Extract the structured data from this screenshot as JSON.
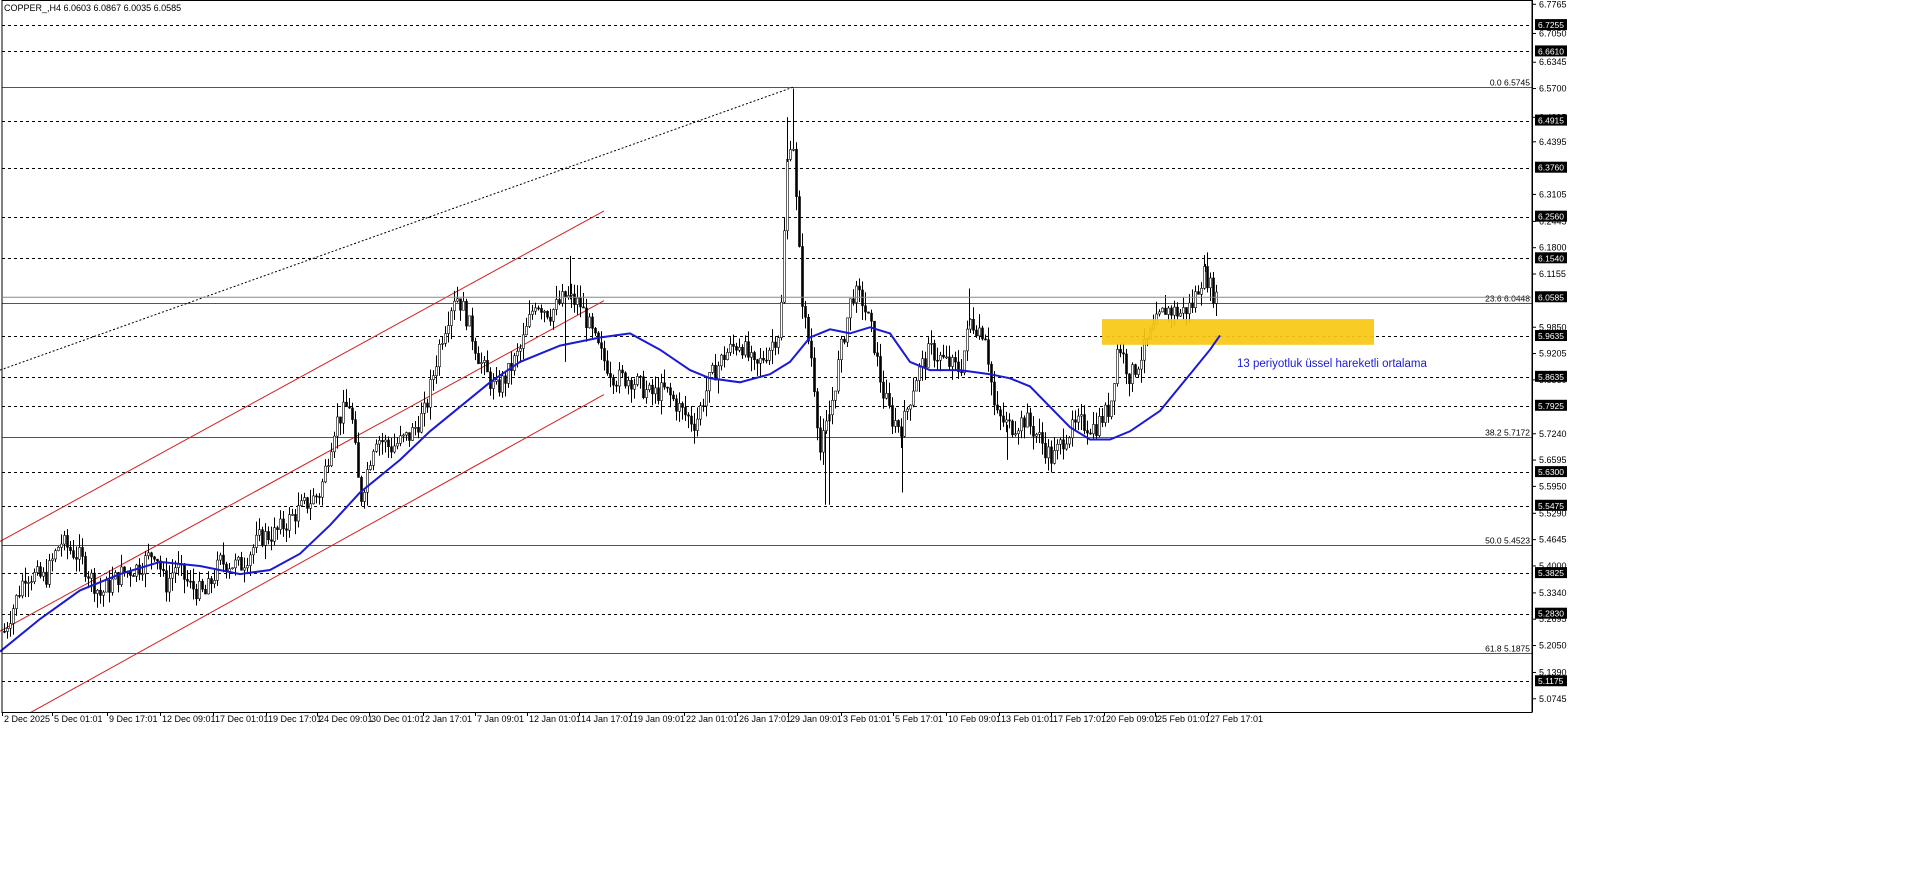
{
  "chart_data": {
    "type": "candlestick",
    "title": "COPPER_,H4  6.0603 6.0867 6.0035 6.0585",
    "ylim": [
      5.0,
      6.7765
    ],
    "yticks": [
      "6.7765",
      "6.7050",
      "6.6345",
      "6.5700",
      "6.4995",
      "6.4395",
      "6.3105",
      "6.2445",
      "6.1800",
      "6.1155",
      "5.9850",
      "5.9205",
      "5.8560",
      "5.7240",
      "5.6595",
      "5.5950",
      "5.5290",
      "5.4645",
      "5.4000",
      "5.3340",
      "5.2695",
      "5.2050",
      "5.1390",
      "5.0745"
    ],
    "xticks": [
      "2 Dec 2025",
      "5 Dec 01:01",
      "9 Dec 17:01",
      "12 Dec 09:01",
      "17 Dec 01:01",
      "19 Dec 17:01",
      "24 Dec 09:01",
      "30 Dec 01:01",
      "2 Jan 17:01",
      "7 Jan 09:01",
      "12 Jan 01:01",
      "14 Jan 17:01",
      "19 Jan 09:01",
      "22 Jan 01:01",
      "26 Jan 17:01",
      "29 Jan 09:01",
      "3 Feb 01:01",
      "5 Feb 17:01",
      "10 Feb 09:01",
      "13 Feb 01:01",
      "17 Feb 17:01",
      "20 Feb 09:01",
      "25 Feb 01:01",
      "27 Feb 17:01"
    ],
    "level_lines": [
      {
        "price": 6.7255,
        "label": "6.7255"
      },
      {
        "price": 6.661,
        "label": "6.6610"
      },
      {
        "price": 6.4915,
        "label": "6.4915"
      },
      {
        "price": 6.376,
        "label": "6.3760"
      },
      {
        "price": 6.256,
        "label": "6.2560"
      },
      {
        "price": 6.154,
        "label": "6.1540"
      },
      {
        "price": 5.9635,
        "label": "5.9635"
      },
      {
        "price": 5.8635,
        "label": "5.8635"
      },
      {
        "price": 5.7925,
        "label": "5.7925"
      },
      {
        "price": 5.63,
        "label": "5.6300"
      },
      {
        "price": 5.5475,
        "label": "5.5475"
      },
      {
        "price": 5.3825,
        "label": "5.3825"
      },
      {
        "price": 5.283,
        "label": "5.2830"
      },
      {
        "price": 5.1175,
        "label": "5.1175"
      }
    ],
    "fib_levels": [
      {
        "price": 6.5745,
        "label": "0.0 6.5745"
      },
      {
        "price": 6.0448,
        "label": "23.6 6.0448"
      },
      {
        "price": 5.7172,
        "label": "38.2 5.7172"
      },
      {
        "price": 5.4523,
        "label": "50.0 5.4523"
      },
      {
        "price": 5.1875,
        "label": "61.8 5.1875"
      }
    ],
    "current_price": {
      "price": 6.0585,
      "label": "6.0585"
    },
    "ema_annotation": "13 periyotluk üssel hareketli ortalama",
    "ema_path": [
      [
        0,
        5.19
      ],
      [
        40,
        5.27
      ],
      [
        80,
        5.34
      ],
      [
        120,
        5.38
      ],
      [
        160,
        5.41
      ],
      [
        200,
        5.4
      ],
      [
        240,
        5.38
      ],
      [
        270,
        5.39
      ],
      [
        300,
        5.43
      ],
      [
        330,
        5.5
      ],
      [
        360,
        5.58
      ],
      [
        400,
        5.66
      ],
      [
        430,
        5.73
      ],
      [
        460,
        5.79
      ],
      [
        490,
        5.85
      ],
      [
        520,
        5.9
      ],
      [
        560,
        5.94
      ],
      [
        600,
        5.96
      ],
      [
        630,
        5.97
      ],
      [
        660,
        5.93
      ],
      [
        690,
        5.88
      ],
      [
        710,
        5.86
      ],
      [
        740,
        5.85
      ],
      [
        770,
        5.87
      ],
      [
        790,
        5.9
      ],
      [
        810,
        5.96
      ],
      [
        830,
        5.98
      ],
      [
        850,
        5.97
      ],
      [
        870,
        5.985
      ],
      [
        890,
        5.97
      ],
      [
        910,
        5.9
      ],
      [
        930,
        5.88
      ],
      [
        960,
        5.88
      ],
      [
        990,
        5.87
      ],
      [
        1010,
        5.86
      ],
      [
        1030,
        5.84
      ],
      [
        1050,
        5.79
      ],
      [
        1070,
        5.74
      ],
      [
        1090,
        5.71
      ],
      [
        1110,
        5.71
      ],
      [
        1130,
        5.73
      ],
      [
        1160,
        5.78
      ],
      [
        1190,
        5.87
      ],
      [
        1210,
        5.93
      ],
      [
        1220,
        5.965
      ]
    ],
    "channel": {
      "lines": [
        [
          [
            0,
            5.46
          ],
          [
            604,
            6.27
          ]
        ],
        [
          [
            0,
            5.24
          ],
          [
            604,
            6.05
          ]
        ],
        [
          [
            30,
            5.04
          ],
          [
            604,
            5.82
          ]
        ]
      ]
    },
    "dotted_trend": [
      [
        0,
        5.88
      ],
      [
        795,
        6.575
      ]
    ],
    "zone": {
      "x1": 1102,
      "x2": 1374,
      "top": 6.005,
      "bottom": 5.942
    }
  }
}
